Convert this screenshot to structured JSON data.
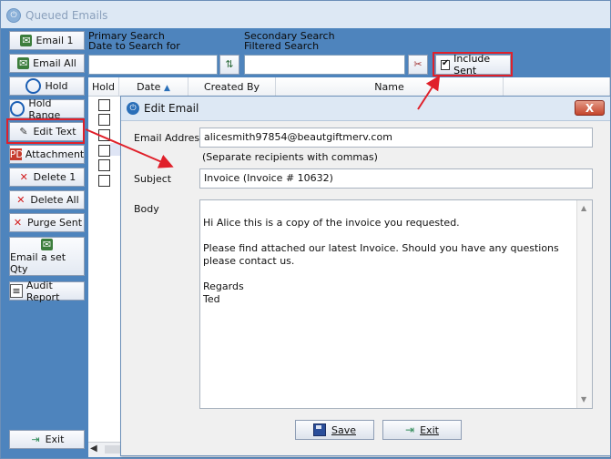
{
  "window": {
    "title": "Queued Emails"
  },
  "sidebar": {
    "buttons": [
      {
        "label": "Email 1",
        "icon": "email-icon"
      },
      {
        "label": "Email All",
        "icon": "email-icon"
      },
      {
        "label": "Hold",
        "icon": "hold-icon"
      },
      {
        "label": "Hold Range",
        "icon": "hold-icon"
      },
      {
        "label": "Edit Text",
        "icon": "pencil-icon"
      },
      {
        "label": "Attachment",
        "icon": "pdf-icon"
      },
      {
        "label": "Delete 1",
        "icon": "delete-icon"
      },
      {
        "label": "Delete All",
        "icon": "delete-icon"
      },
      {
        "label": "Purge Sent",
        "icon": "delete-icon"
      },
      {
        "label": "Email a set Qty",
        "icon": "email-icon"
      },
      {
        "label": "Audit Report",
        "icon": "report-icon"
      }
    ],
    "exit_label": "Exit"
  },
  "search": {
    "primary_label": "Primary Search",
    "primary_sub": "Date to Search for",
    "secondary_label": "Secondary Search",
    "secondary_sub": "Filtered Search",
    "include_sent_label": "Include Sent",
    "include_sent_checked": true
  },
  "grid": {
    "columns": [
      "Hold",
      "Date",
      "Created By",
      "Name"
    ],
    "sort_indicator": "▲",
    "row_count": 6
  },
  "dialog": {
    "title": "Edit Email",
    "close_label": "X",
    "email_address_label": "Email Address",
    "email_address_value": "alicesmith97854@beautgiftmerv.com",
    "email_hint": "(Separate recipients with commas)",
    "subject_label": "Subject",
    "subject_value": "Invoice (Invoice # 10632)",
    "body_label": "Body",
    "body_value": "Hi Alice this is a copy of the invoice you requested.\n\nPlease find attached our latest Invoice. Should you have any questions please contact us.\n\nRegards\nTed",
    "save_label": "Save",
    "exit_label": "Exit"
  },
  "colors": {
    "sidebar_bg": "#4e84bd",
    "annotation_red": "#e0202a"
  }
}
